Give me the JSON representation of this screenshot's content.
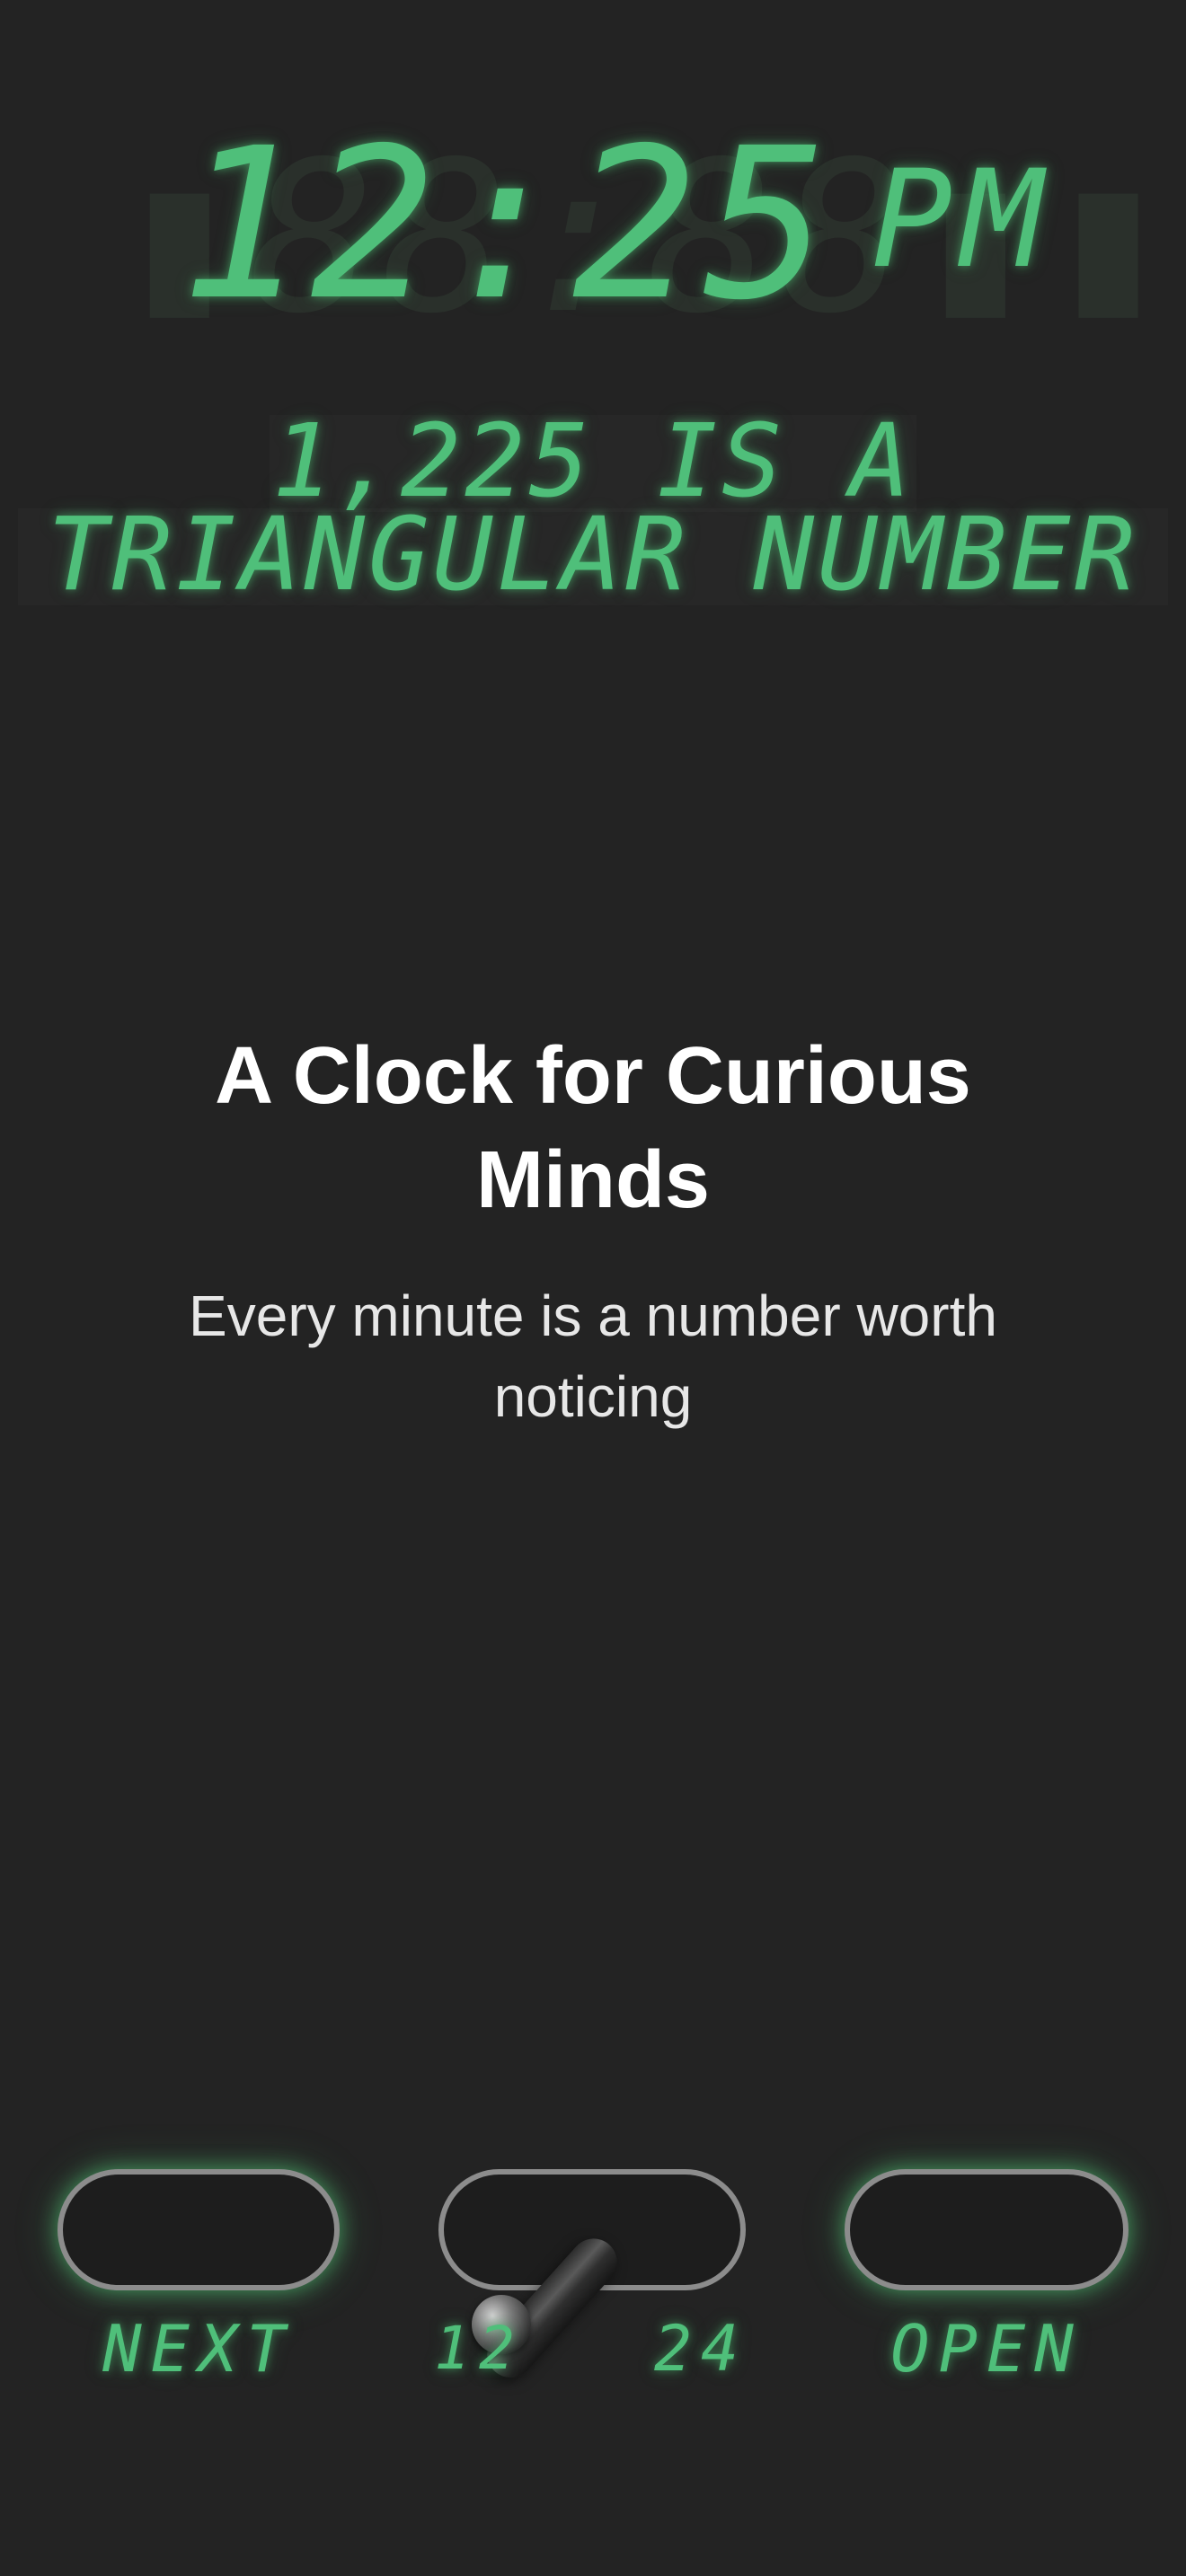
{
  "clock": {
    "time": "12:25",
    "ampm": "PM",
    "ghost": "88:88"
  },
  "fact": {
    "line1": "1,225 IS A",
    "line2": "TRIANGULAR NUMBER"
  },
  "headline": {
    "title": "A Clock for Curious Minds",
    "subtitle": "Every minute is a number worth noticing"
  },
  "controls": {
    "next_label": "NEXT",
    "toggle_left_label": "12",
    "toggle_right_label": "24",
    "open_label": "OPEN",
    "toggle_state": "12"
  },
  "colors": {
    "background": "#232323",
    "lcd_green": "#4fbf7a",
    "pill_border": "#8c8c8c"
  }
}
